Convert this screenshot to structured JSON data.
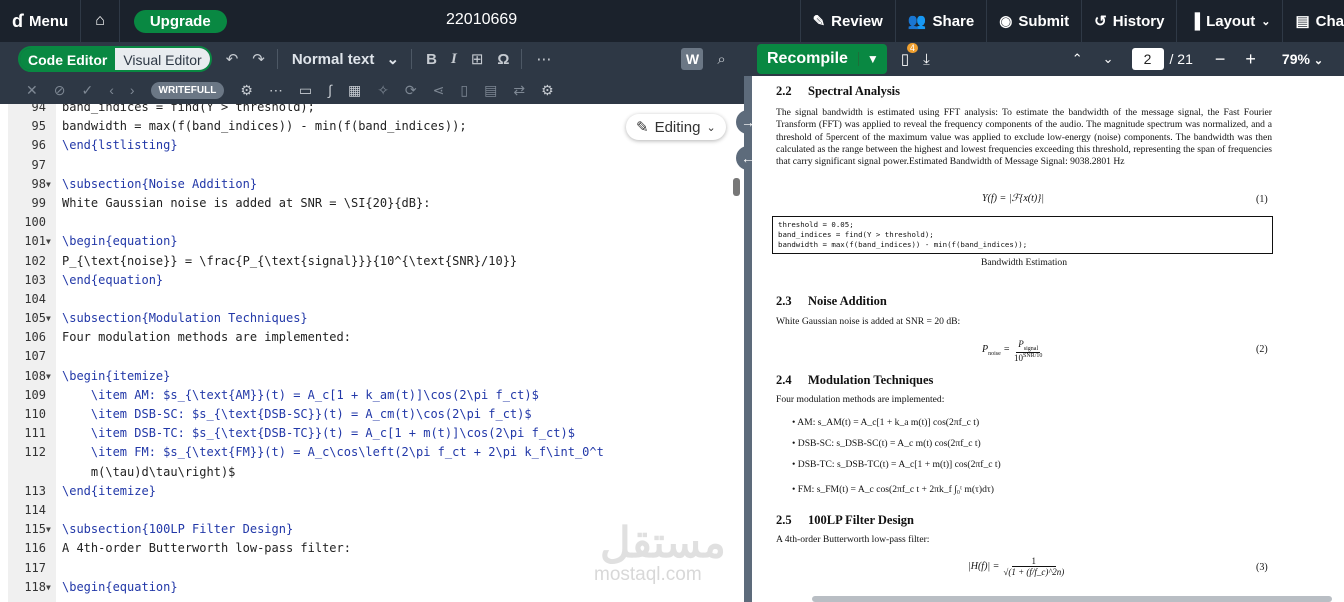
{
  "topbar": {
    "menu": "Menu",
    "upgrade": "Upgrade",
    "project_title": "22010669",
    "review": "Review",
    "share": "Share",
    "submit": "Submit",
    "history": "History",
    "layout": "Layout",
    "chat": "Cha"
  },
  "editor_toolbar": {
    "code_editor": "Code Editor",
    "visual_editor": "Visual Editor",
    "text_style": "Normal text",
    "writefull": "WRITEFULL"
  },
  "editing_chip": "Editing",
  "pdf_toolbar": {
    "recompile": "Recompile",
    "badge": "4",
    "page_current": "2",
    "page_total": "/ 21",
    "zoom": "79%"
  },
  "code_lines": [
    {
      "n": "94",
      "t": "band_indices = find(Y > threshold);"
    },
    {
      "n": "95",
      "t": "bandwidth = max(f(band_indices)) - min(f(band_indices));"
    },
    {
      "n": "96",
      "t": "\\end{lstlisting}"
    },
    {
      "n": "97",
      "t": ""
    },
    {
      "n": "98",
      "t": "\\subsection{Noise Addition}",
      "fold": true
    },
    {
      "n": "99",
      "t": "White Gaussian noise is added at SNR = \\SI{20}{dB}:"
    },
    {
      "n": "100",
      "t": ""
    },
    {
      "n": "101",
      "t": "\\begin{equation}",
      "fold": true
    },
    {
      "n": "102",
      "t": "P_{\\text{noise}} = \\frac{P_{\\text{signal}}}{10^{\\text{SNR}/10}}"
    },
    {
      "n": "103",
      "t": "\\end{equation}"
    },
    {
      "n": "104",
      "t": ""
    },
    {
      "n": "105",
      "t": "\\subsection{Modulation Techniques}",
      "fold": true
    },
    {
      "n": "106",
      "t": "Four modulation methods are implemented:"
    },
    {
      "n": "107",
      "t": ""
    },
    {
      "n": "108",
      "t": "\\begin{itemize}",
      "fold": true
    },
    {
      "n": "109",
      "t": "    \\item AM: $s_{\\text{AM}}(t) = A_c[1 + k_am(t)]\\cos(2\\pi f_ct)$"
    },
    {
      "n": "110",
      "t": "    \\item DSB-SC: $s_{\\text{DSB-SC}}(t) = A_cm(t)\\cos(2\\pi f_ct)$"
    },
    {
      "n": "111",
      "t": "    \\item DSB-TC: $s_{\\text{DSB-TC}}(t) = A_c[1 + m(t)]\\cos(2\\pi f_ct)$"
    },
    {
      "n": "112",
      "t": "    \\item FM: $s_{\\text{FM}}(t) = A_c\\cos\\left(2\\pi f_ct + 2\\pi k_f\\int_0^t"
    },
    {
      "n": "",
      "t": "    m(\\tau)d\\tau\\right)$"
    },
    {
      "n": "113",
      "t": "\\end{itemize}"
    },
    {
      "n": "114",
      "t": ""
    },
    {
      "n": "115",
      "t": "\\subsection{100LP Filter Design}",
      "fold": true
    },
    {
      "n": "116",
      "t": "A 4th-order Butterworth low-pass filter:"
    },
    {
      "n": "117",
      "t": ""
    },
    {
      "n": "118",
      "t": "\\begin{equation}",
      "fold": true
    }
  ],
  "pdf": {
    "s22_num": "2.2",
    "s22_title": "Spectral Analysis",
    "s22_para": "The signal bandwidth is estimated using FFT analysis: To estimate the bandwidth of the message signal, the Fast Fourier Transform (FFT) was applied to reveal the frequency components of the audio. The magnitude spectrum was normalized, and a threshold of 5percent of the maximum value was applied to exclude low-energy (noise) components. The bandwidth was then calculated as the range between the highest and lowest frequencies exceeding this threshold, representing the span of frequencies that carry significant signal power.Estimated Bandwidth of Message Signal: 9038.2801 Hz",
    "eq1": "Y(f) = |ℱ{x(t)}|",
    "eq1_num": "(1)",
    "listing": [
      "threshold = 0.05;",
      "band_indices = find(Y > threshold);",
      "bandwidth = max(f(band_indices)) - min(f(band_indices));"
    ],
    "listing_caption": "Bandwidth Estimation",
    "s23_num": "2.3",
    "s23_title": "Noise Addition",
    "s23_para": "White Gaussian noise is added at SNR = 20 dB:",
    "eq2_lhs": "P",
    "eq2_lhs_sub": "noise",
    "eq2_numer": "P",
    "eq2_numer_sub": "signal",
    "eq2_denom": "10",
    "eq2_denom_sup": "SNR/10",
    "eq2_num": "(2)",
    "s24_num": "2.4",
    "s24_title": "Modulation Techniques",
    "s24_para": "Four modulation methods are implemented:",
    "bullets": [
      "AM: s_AM(t) = A_c[1 + k_a m(t)] cos(2πf_c t)",
      "DSB-SC: s_DSB-SC(t) = A_c m(t) cos(2πf_c t)",
      "DSB-TC: s_DSB-TC(t) = A_c[1 + m(t)] cos(2πf_c t)",
      "FM: s_FM(t) = A_c cos(2πf_c t + 2πk_f ∫₀ᵗ m(τ)dτ)"
    ],
    "s25_num": "2.5",
    "s25_title": "100LP Filter Design",
    "s25_para": "A 4th-order Butterworth low-pass filter:",
    "eq3_lhs": "|H(f)| =",
    "eq3_numer": "1",
    "eq3_denom": "√(1 + (f/f_c)^2n)",
    "eq3_num": "(3)"
  },
  "watermark": {
    "arabic": "مستقل",
    "latin": "mostaql.com"
  }
}
